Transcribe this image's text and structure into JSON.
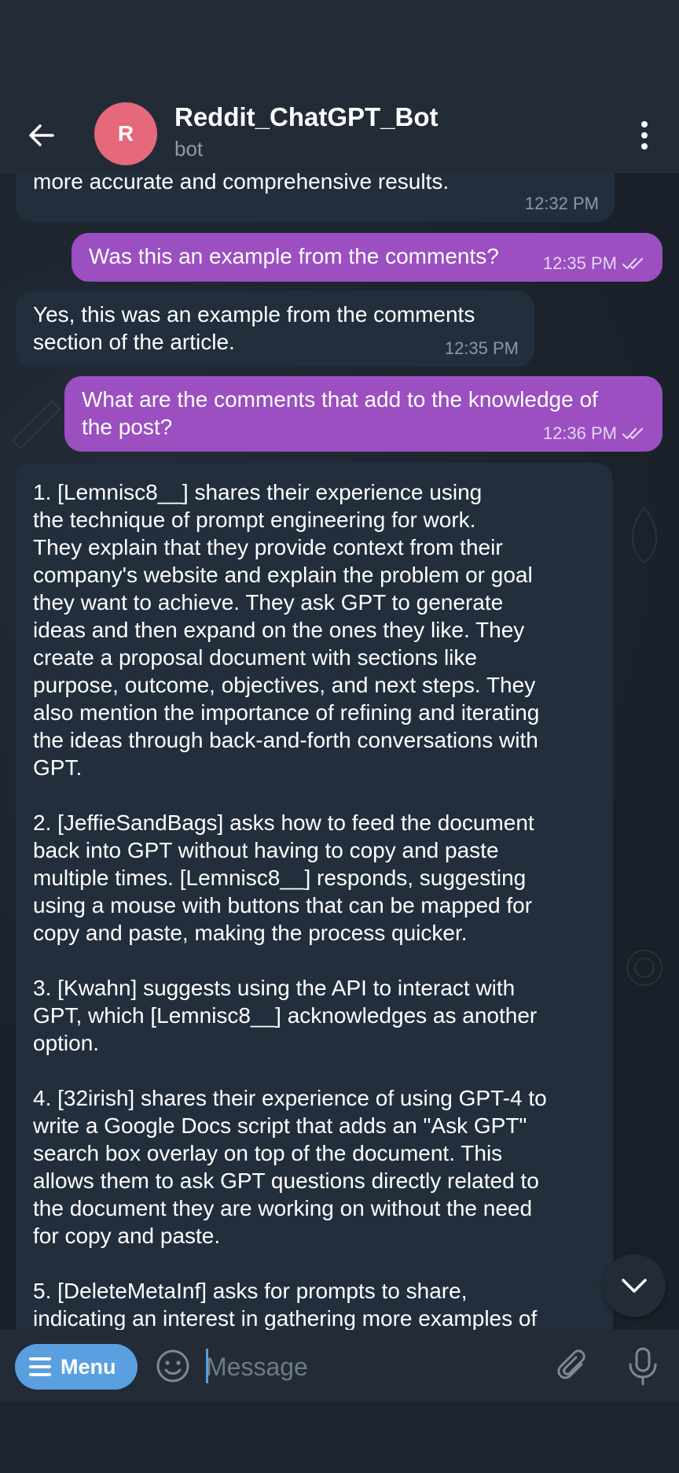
{
  "chat": {
    "title": "Reddit_ChatGPT_Bot",
    "subtitle": "bot",
    "avatar_letter": "R"
  },
  "messages": [
    {
      "direction": "in",
      "text": "feedback. This collaborative approach can lead to\nmore accurate and comprehensive results.",
      "time": "12:32 PM"
    },
    {
      "direction": "out",
      "text": "Was this an example from the comments?",
      "time": "12:35 PM",
      "status": "read"
    },
    {
      "direction": "in",
      "text": "Yes, this was an example from the comments\nsection of the article.",
      "time": "12:35 PM"
    },
    {
      "direction": "out",
      "text": "What are the comments that add to the knowledge of\nthe post?",
      "time": "12:36 PM",
      "status": "read"
    },
    {
      "direction": "in",
      "text": "1. [Lemnisc8__] shares their experience using\nthe technique of prompt engineering for work.\nThey explain that they provide context from their\ncompany's website and explain the problem or goal\nthey want to achieve. They ask GPT to generate\nideas and then expand on the ones they like. They\ncreate a proposal document with sections like\npurpose, outcome, objectives, and next steps. They\nalso mention the importance of refining and iterating\nthe ideas through back-and-forth conversations with\nGPT.\n\n2. [JeffieSandBags] asks how to feed the document\nback into GPT without having to copy and paste\nmultiple times. [Lemnisc8__] responds, suggesting\nusing a mouse with buttons that can be mapped for\ncopy and paste, making the process quicker.\n\n3. [Kwahn] suggests using the API to interact with\nGPT, which [Lemnisc8__] acknowledges as another\noption.\n\n4. [32irish] shares their experience of using GPT-4 to\nwrite a Google Docs script that adds an \"Ask GPT\"\nsearch box overlay on top of the document. This\nallows them to ask GPT questions directly related to\nthe document they are working on without the need\nfor copy and paste.\n\n5. [DeleteMetaInf] asks for prompts to share,\nindicating an interest in gathering more examples of"
    }
  ],
  "composer": {
    "menu_label": "Menu",
    "placeholder": "Message"
  },
  "icons": {
    "back": "arrow-left-icon",
    "more": "more-vertical-icon",
    "emoji": "emoji-icon",
    "attach": "paperclip-icon",
    "mic": "microphone-icon",
    "scroll": "chevron-down-icon",
    "read": "double-check-icon"
  },
  "colors": {
    "accent": "#5a9fe0",
    "outgoing_bubble": "#9b4fc1",
    "incoming_bubble": "#232e3c",
    "avatar": "#e5687b",
    "header": "#222b36"
  }
}
